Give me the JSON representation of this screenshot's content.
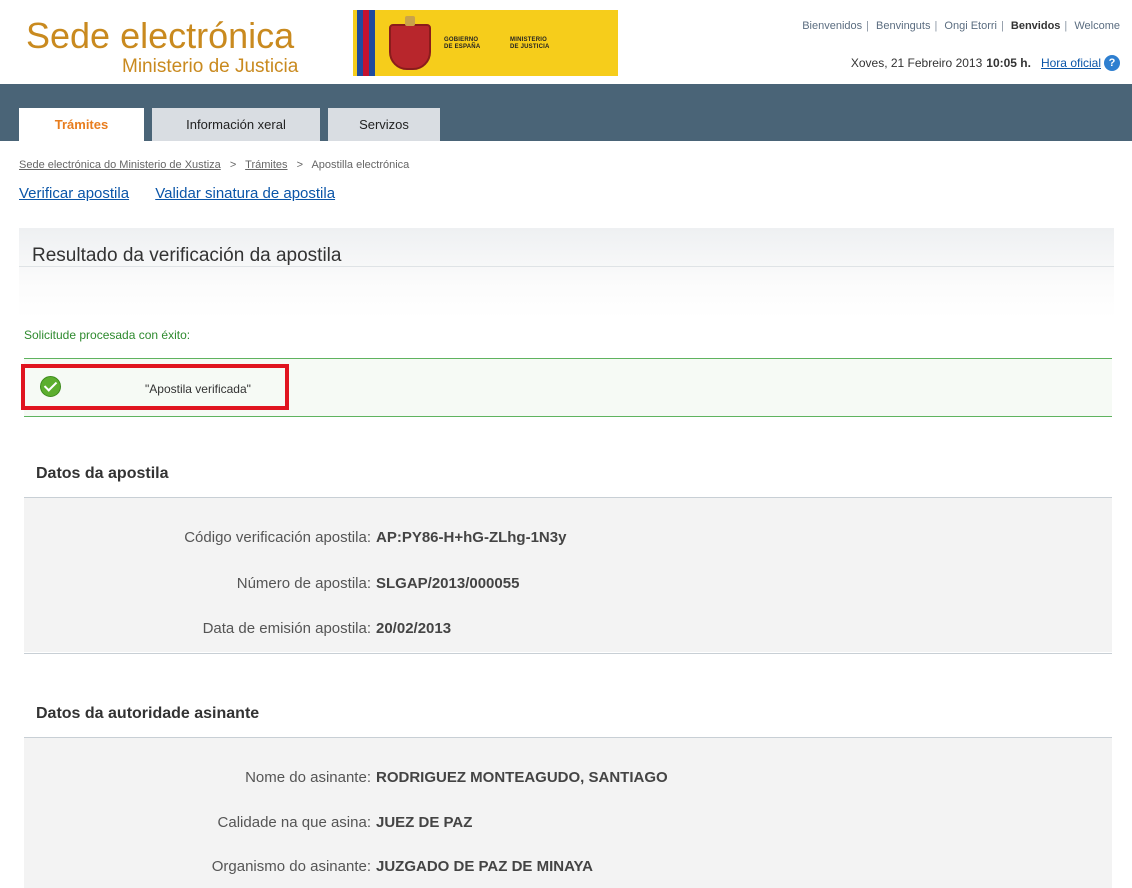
{
  "header": {
    "brand_title": "Sede electrónica",
    "brand_subtitle": "Ministerio de Justicia",
    "gov_logo_line1": "GOBIERNO",
    "gov_logo_line2": "DE ESPAÑA",
    "ministry_line1": "MINISTERIO",
    "ministry_line2": "DE JUSTICIA",
    "languages": [
      "Bienvenidos",
      "Benvinguts",
      "Ongi Etorri",
      "Benvidos",
      "Welcome"
    ],
    "active_language": "Benvidos",
    "date": "Xoves, 21 Febreiro 2013",
    "time": "10:05 h.",
    "official_time_link": "Hora oficial",
    "help_icon": "?"
  },
  "nav": {
    "tabs": [
      "Trámites",
      "Información xeral",
      "Servizos"
    ],
    "active_tab": "Trámites"
  },
  "breadcrumb": {
    "items": [
      "Sede electrónica do Ministerio de Xustiza",
      "Trámites",
      "Apostilla electrónica"
    ],
    "separator": ">"
  },
  "sublinks": [
    "Verificar apostila",
    "Validar sinatura de apostila"
  ],
  "result": {
    "title": "Resultado da verificación da apostila",
    "success_message": "Solicitude procesada con éxito:",
    "verified_text": "\"Apostila verificada\""
  },
  "apostille_section": {
    "title": "Datos da apostila",
    "rows": [
      {
        "label": "Código verificación apostila:",
        "value": "AP:PY86-H+hG-ZLhg-1N3y"
      },
      {
        "label": "Número de apostila:",
        "value": "SLGAP/2013/000055"
      },
      {
        "label": "Data de emisión apostila:",
        "value": "20/02/2013"
      }
    ]
  },
  "authority_section": {
    "title": "Datos da autoridade asinante",
    "rows": [
      {
        "label": "Nome do asinante:",
        "value": "RODRIGUEZ MONTEAGUDO, SANTIAGO"
      },
      {
        "label": "Calidade na que asina:",
        "value": "JUEZ DE PAZ"
      },
      {
        "label": "Organismo do asinante:",
        "value": "JUZGADO DE PAZ DE MINAYA"
      }
    ]
  },
  "colors": {
    "brand": "#c98a1f",
    "nav_bg": "#4a6477",
    "active_tab_text": "#e87d1e",
    "link": "#0a55a8",
    "success": "#2e8a2e",
    "highlight": "#e0141f"
  }
}
